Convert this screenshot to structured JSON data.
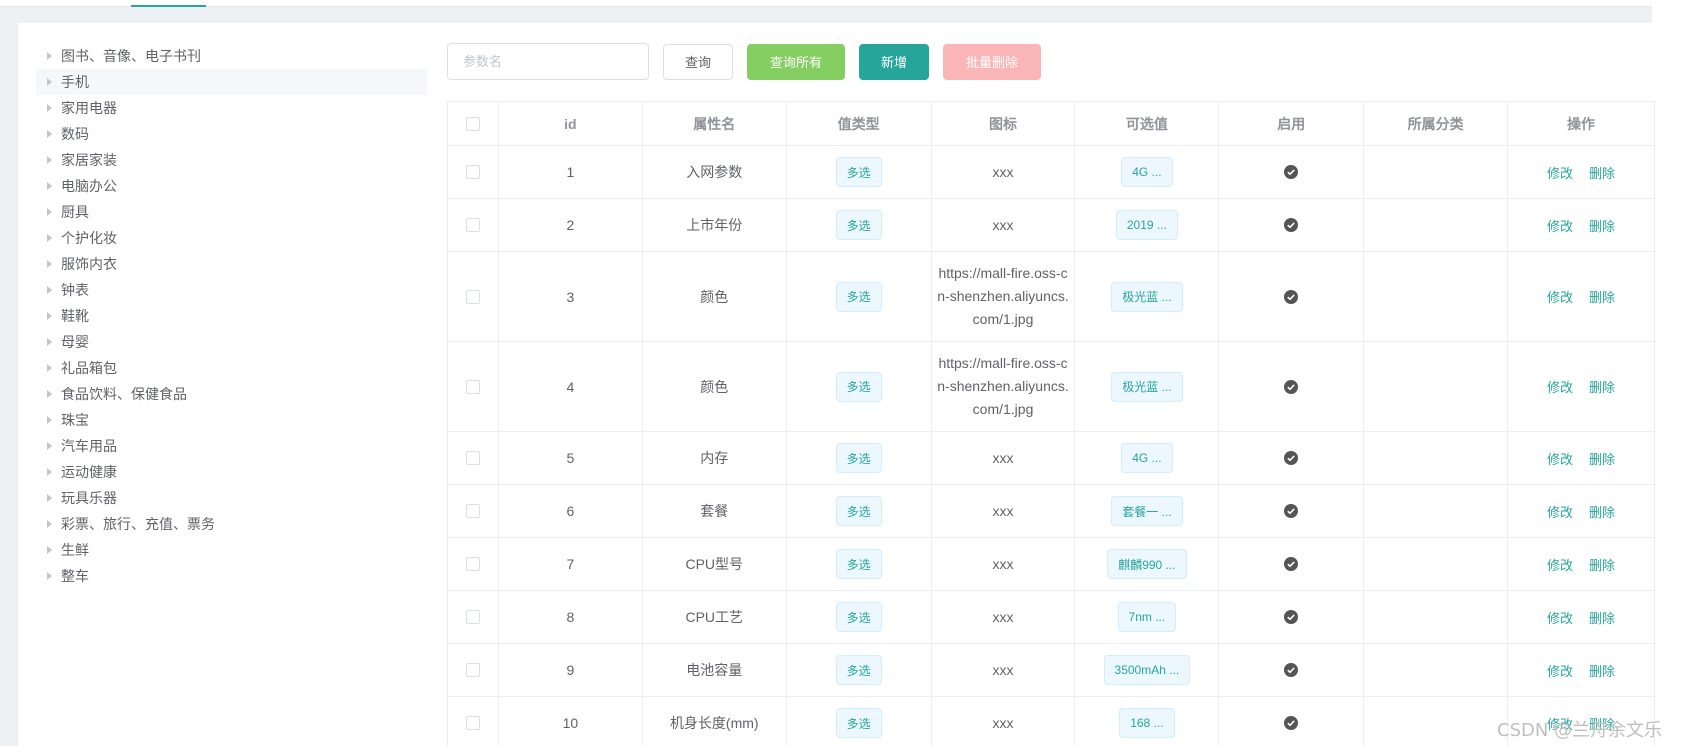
{
  "categories": [
    {
      "label": "图书、音像、电子书刊",
      "selected": false
    },
    {
      "label": "手机",
      "selected": true
    },
    {
      "label": "家用电器",
      "selected": false
    },
    {
      "label": "数码",
      "selected": false
    },
    {
      "label": "家居家装",
      "selected": false
    },
    {
      "label": "电脑办公",
      "selected": false
    },
    {
      "label": "厨具",
      "selected": false
    },
    {
      "label": "个护化妆",
      "selected": false
    },
    {
      "label": "服饰内衣",
      "selected": false
    },
    {
      "label": "钟表",
      "selected": false
    },
    {
      "label": "鞋靴",
      "selected": false
    },
    {
      "label": "母婴",
      "selected": false
    },
    {
      "label": "礼品箱包",
      "selected": false
    },
    {
      "label": "食品饮料、保健食品",
      "selected": false
    },
    {
      "label": "珠宝",
      "selected": false
    },
    {
      "label": "汽车用品",
      "selected": false
    },
    {
      "label": "运动健康",
      "selected": false
    },
    {
      "label": "玩具乐器",
      "selected": false
    },
    {
      "label": "彩票、旅行、充值、票务",
      "selected": false
    },
    {
      "label": "生鲜",
      "selected": false
    },
    {
      "label": "整车",
      "selected": false
    }
  ],
  "toolbar": {
    "search_placeholder": "参数名",
    "search_value": "",
    "query_label": "查询",
    "query_all_label": "查询所有",
    "add_label": "新增",
    "batch_delete_label": "批量删除"
  },
  "table": {
    "headers": [
      "",
      "id",
      "属性名",
      "值类型",
      "图标",
      "可选值",
      "启用",
      "所属分类",
      "操作"
    ],
    "rows": [
      {
        "id": "1",
        "name": "入网参数",
        "type": "多选",
        "icon": "xxx",
        "values": "4G ...",
        "enabled": true,
        "category": "",
        "edit": "修改",
        "delete": "删除"
      },
      {
        "id": "2",
        "name": "上市年份",
        "type": "多选",
        "icon": "xxx",
        "values": "2019 ...",
        "enabled": true,
        "category": "",
        "edit": "修改",
        "delete": "删除"
      },
      {
        "id": "3",
        "name": "颜色",
        "type": "多选",
        "icon": "https://mall-fire.oss-cn-shenzhen.aliyuncs.com/1.jpg",
        "values": "极光蓝 ...",
        "enabled": true,
        "category": "",
        "edit": "修改",
        "delete": "删除"
      },
      {
        "id": "4",
        "name": "颜色",
        "type": "多选",
        "icon": "https://mall-fire.oss-cn-shenzhen.aliyuncs.com/1.jpg",
        "values": "极光蓝 ...",
        "enabled": true,
        "category": "",
        "edit": "修改",
        "delete": "删除"
      },
      {
        "id": "5",
        "name": "内存",
        "type": "多选",
        "icon": "xxx",
        "values": "4G ...",
        "enabled": true,
        "category": "",
        "edit": "修改",
        "delete": "删除"
      },
      {
        "id": "6",
        "name": "套餐",
        "type": "多选",
        "icon": "xxx",
        "values": "套餐一 ...",
        "enabled": true,
        "category": "",
        "edit": "修改",
        "delete": "删除"
      },
      {
        "id": "7",
        "name": "CPU型号",
        "type": "多选",
        "icon": "xxx",
        "values": "麒麟990 ...",
        "enabled": true,
        "category": "",
        "edit": "修改",
        "delete": "删除"
      },
      {
        "id": "8",
        "name": "CPU工艺",
        "type": "多选",
        "icon": "xxx",
        "values": "7nm ...",
        "enabled": true,
        "category": "",
        "edit": "修改",
        "delete": "删除"
      },
      {
        "id": "9",
        "name": "电池容量",
        "type": "多选",
        "icon": "xxx",
        "values": "3500mAh ...",
        "enabled": true,
        "category": "",
        "edit": "修改",
        "delete": "删除"
      },
      {
        "id": "10",
        "name": "机身长度(mm)",
        "type": "多选",
        "icon": "xxx",
        "values": "168 ...",
        "enabled": true,
        "category": "",
        "edit": "修改",
        "delete": "删除"
      }
    ]
  },
  "watermark": "CSDN @兰舟余文乐",
  "colors": {
    "accent": "#26a69a",
    "success": "#85ce61",
    "danger_disabled": "#fab6b6",
    "tag_bg": "#ecf7ff"
  },
  "icons": {
    "tree_caret": "caret-right-icon",
    "enabled": "check-circle-icon"
  }
}
